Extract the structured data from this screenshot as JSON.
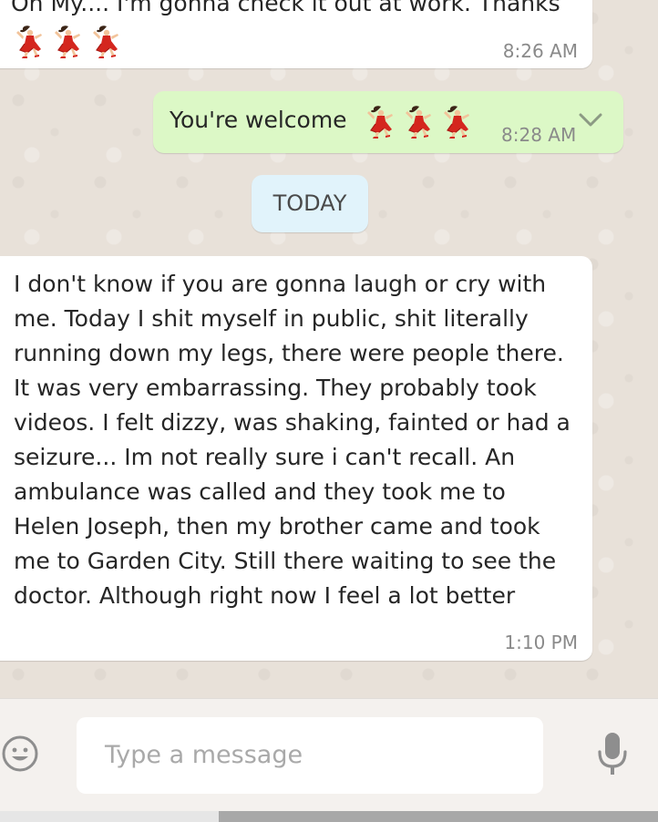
{
  "messages": [
    {
      "direction": "incoming",
      "text": "Oh My.... I'm gonna check it out at work. Thanks",
      "emojis": [
        "dancer",
        "dancer",
        "dancer"
      ],
      "time": "8:26 AM"
    },
    {
      "direction": "outgoing",
      "text": "You're welcome",
      "emojis": [
        "dancer",
        "dancer",
        "dancer"
      ],
      "time": "8:28 AM"
    },
    {
      "direction": "incoming",
      "text": "I don't know if you are gonna laugh or cry with me. Today I shit myself in public, shit literally running down my legs, there were people there. It was very embarrassing. They probably took videos. I felt dizzy, was shaking, fainted or had a seizure... Im not really sure i can't recall. An ambulance was called and they took me to Helen Joseph, then my brother came and took me to Garden City. Still there waiting to see the doctor. Although right now I feel a lot better",
      "time": "1:10 PM"
    }
  ],
  "date_divider": "TODAY",
  "composer": {
    "placeholder": "Type a message",
    "emoji_icon": "smiley-icon",
    "mic_icon": "microphone-icon"
  },
  "colors": {
    "incoming_bubble": "#ffffff",
    "outgoing_bubble": "#dcf8c6",
    "date_chip": "#e1f3fb",
    "chat_background": "#e8e1d9"
  }
}
